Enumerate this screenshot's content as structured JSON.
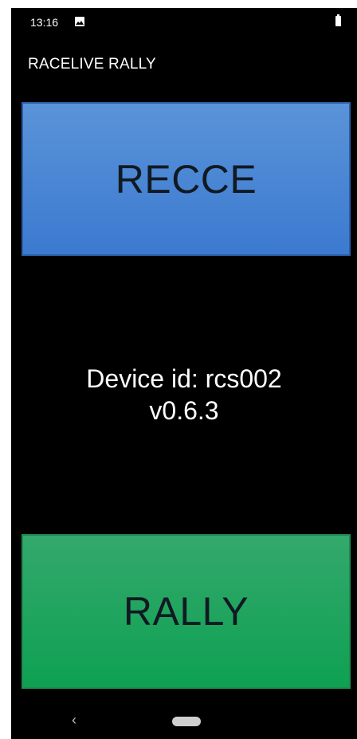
{
  "status_bar": {
    "time": "13:16",
    "notification_icon": "image-icon",
    "battery_icon": "battery-icon"
  },
  "app": {
    "title": "RACELIVE RALLY"
  },
  "buttons": {
    "recce_label": "RECCE",
    "rally_label": "RALLY"
  },
  "device": {
    "id_line": "Device id: rcs002",
    "version": "v0.6.3"
  },
  "nav_bar": {
    "back_glyph": "‹",
    "back_icon": "back-icon",
    "home_icon": "home-pill-icon"
  },
  "colors": {
    "background": "#000000",
    "recce_button": "#4a86d6",
    "rally_button": "#1fa35f",
    "button_text": "#111a22",
    "text": "#ffffff"
  }
}
